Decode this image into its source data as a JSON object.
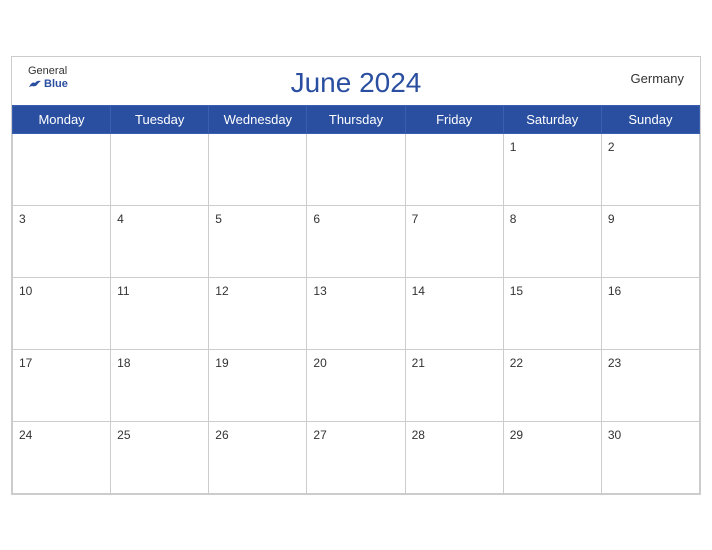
{
  "header": {
    "logo_general": "General",
    "logo_blue": "Blue",
    "title": "June 2024",
    "country": "Germany"
  },
  "weekdays": [
    "Monday",
    "Tuesday",
    "Wednesday",
    "Thursday",
    "Friday",
    "Saturday",
    "Sunday"
  ],
  "weeks": [
    [
      null,
      null,
      null,
      null,
      null,
      1,
      2
    ],
    [
      3,
      4,
      5,
      6,
      7,
      8,
      9
    ],
    [
      10,
      11,
      12,
      13,
      14,
      15,
      16
    ],
    [
      17,
      18,
      19,
      20,
      21,
      22,
      23
    ],
    [
      24,
      25,
      26,
      27,
      28,
      29,
      30
    ]
  ]
}
